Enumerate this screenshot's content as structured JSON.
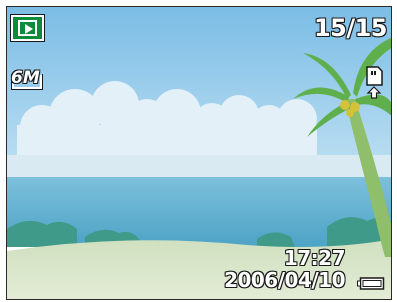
{
  "screen": {
    "frame_counter": "15/15",
    "time": "17:27",
    "date": "2006/04/10",
    "resolution_label": "6M"
  },
  "icons": {
    "mode": "playback-mode-icon",
    "resolution": "resolution-6m-icon",
    "protect": "memory-card-icon",
    "battery": "battery-icon"
  },
  "colors": {
    "mode_icon_bg": "#0a8c3a",
    "sky_top": "#86c4ea",
    "sea": "#5aaecd",
    "sand": "#d8e6c4",
    "osd_text": "#ffffff"
  }
}
